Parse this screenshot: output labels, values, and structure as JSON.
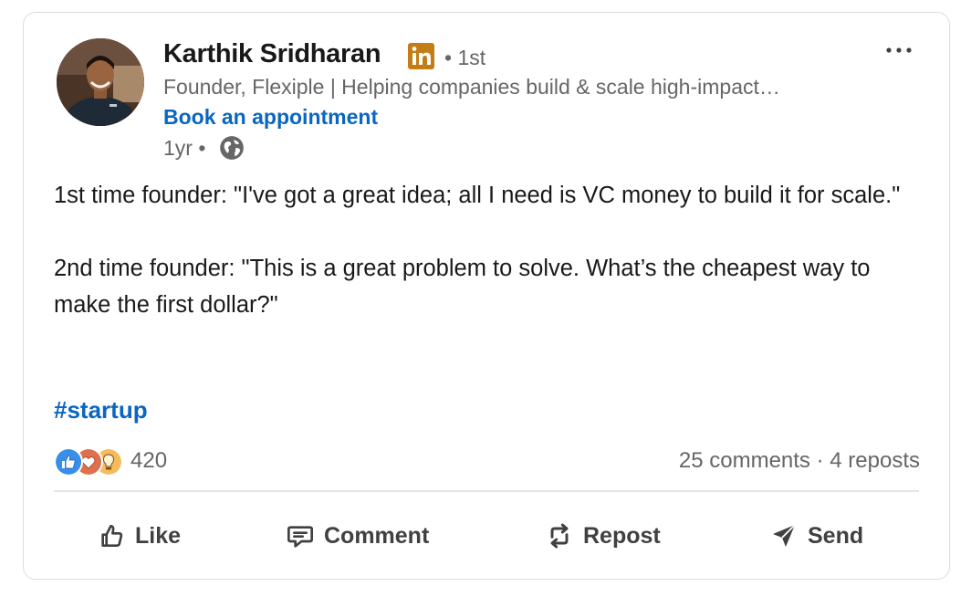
{
  "post": {
    "author": {
      "name": "Karthik Sridharan",
      "degree": "• 1st",
      "headline": "Founder, Flexiple | Helping companies build & scale high-impact…",
      "cta": "Book an appointment",
      "time": "1yr •"
    },
    "body": {
      "para1": "1st time founder: \"I've got a great idea; all I need is VC money to build it for scale.\"",
      "para2": "2nd time founder: \"This is a great problem to solve. What’s the cheapest way to make the first dollar?\""
    },
    "hashtag": "#startup",
    "social": {
      "reaction_icons": [
        "like-icon",
        "love-icon",
        "insightful-icon"
      ],
      "reaction_count": "420",
      "comments": "25 comments",
      "separator": "·",
      "reposts": "4 reposts"
    },
    "actions": {
      "like": "Like",
      "comment": "Comment",
      "repost": "Repost",
      "send": "Send"
    }
  },
  "colors": {
    "link_blue": "#0a66c2",
    "secondary_text": "#666666",
    "linkedin_badge": "#c37d16"
  }
}
